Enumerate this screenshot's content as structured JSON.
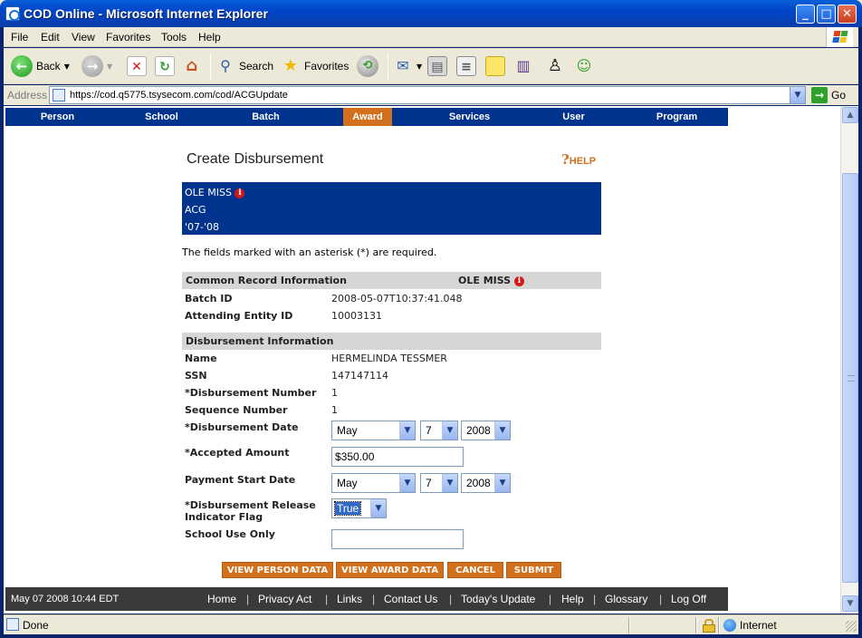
{
  "window": {
    "title": "COD Online - Microsoft Internet Explorer",
    "minimize": "_",
    "maximize": "□",
    "close": "✕"
  },
  "menubar": [
    "File",
    "Edit",
    "View",
    "Favorites",
    "Tools",
    "Help"
  ],
  "toolbar": {
    "back_label": "Back",
    "search_label": "Search",
    "favorites_label": "Favorites"
  },
  "address": {
    "label": "Address",
    "url": "https://cod.q5775.tsysecom.com/cod/ACGUpdate",
    "go_label": "Go"
  },
  "site_nav": {
    "items": [
      "Person",
      "School",
      "Batch",
      "Award",
      "Services",
      "User",
      "Program"
    ],
    "active": "Award"
  },
  "page": {
    "title": "Create Disbursement",
    "help_label": "HELP",
    "school_box": {
      "school": "OLE MISS",
      "award_type": "ACG",
      "award_year": "'07-'08"
    },
    "required_note": "The fields marked with an asterisk (*) are required."
  },
  "common_record": {
    "header": "Common Record Information",
    "header_school": "OLE MISS",
    "fields": {
      "batch_id_label": "Batch ID",
      "batch_id_value": "2008-05-07T10:37:41.048",
      "attending_entity_label": "Attending Entity ID",
      "attending_entity_value": "10003131"
    }
  },
  "disbursement": {
    "header": "Disbursement Information",
    "name_label": "Name",
    "name_value": "HERMELINDA TESSMER",
    "ssn_label": "SSN",
    "ssn_value": "147147114",
    "disb_number_label": "*Disbursement Number",
    "disb_number_value": "1",
    "sequence_label": "Sequence Number",
    "sequence_value": "1",
    "disb_date_label": "*Disbursement Date",
    "disb_date_month": "May",
    "disb_date_day": "7",
    "disb_date_year": "2008",
    "accepted_amount_label": "*Accepted Amount",
    "accepted_amount_value": "$350.00",
    "payment_start_label": "Payment Start Date",
    "payment_start_month": "May",
    "payment_start_day": "7",
    "payment_start_year": "2008",
    "release_flag_label_1": "*Disbursement Release",
    "release_flag_label_2": "Indicator Flag",
    "release_flag_value": "True",
    "school_use_label": "School Use Only",
    "school_use_value": ""
  },
  "actions": {
    "view_person": "VIEW PERSON DATA",
    "view_award": "VIEW AWARD DATA",
    "cancel": "CANCEL",
    "submit": "SUBMIT"
  },
  "footer": {
    "timestamp": "May 07 2008 10:44 EDT",
    "links": [
      "Home",
      "Privacy Act",
      "Links",
      "Contact Us",
      "Today's Update",
      "Help",
      "Glossary",
      "Log Off"
    ],
    "separator": "|"
  },
  "status": {
    "text": "Done",
    "zone": "Internet"
  },
  "colors": {
    "nav_blue": "#00338d",
    "accent_orange": "#d2701e",
    "footer_gray": "#3a3a3a"
  }
}
